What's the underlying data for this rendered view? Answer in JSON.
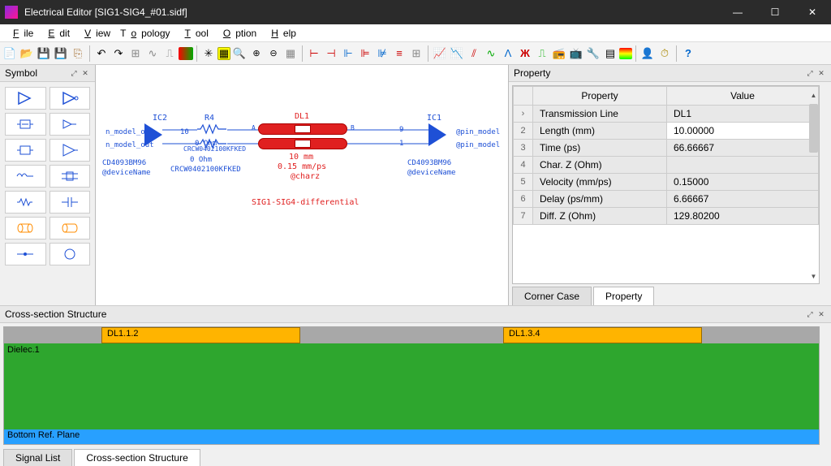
{
  "window": {
    "title": "Electrical Editor [SIG1-SIG4_#01.sidf]"
  },
  "menu": {
    "file": "File",
    "edit": "Edit",
    "view": "View",
    "topology": "Topology",
    "tool": "Tool",
    "option": "Option",
    "help": "Help"
  },
  "symbol_panel": {
    "title": "Symbol"
  },
  "canvas": {
    "ic2": "IC2",
    "ic1": "IC1",
    "r4": "R4",
    "r4ohm": "0 Ohm",
    "r4val": "10",
    "dl1": "DL1",
    "dl1a": "A",
    "dl1b": "B",
    "dl1mm": "10 mm",
    "dl1mmps": "0.15 mm/ps",
    "dl1charz": "@charz",
    "pn_out": "n_model_out",
    "pn_out2": "n_model_out",
    "pn_in": "@pin_model",
    "pn_in2": "@pin_model",
    "cd1": "CD4093BM96",
    "cd1dev": "@deviceName",
    "cd2": "CD4093BM96",
    "cd2dev": "@deviceName",
    "crcw": "CRCW0402100KFKED",
    "crcw2": "CRCW0402100KFKED",
    "ohm0": "0 Ohm",
    "bus9": "9",
    "bus1": "1",
    "netname": "SIG1-SIG4-differential"
  },
  "property": {
    "title": "Property",
    "headers": {
      "prop": "Property",
      "val": "Value"
    },
    "rows": [
      {
        "n": "›",
        "k": "Transmission Line",
        "v": "DL1"
      },
      {
        "n": "2",
        "k": "Length (mm)",
        "v": "10.00000"
      },
      {
        "n": "3",
        "k": "Time (ps)",
        "v": "66.66667"
      },
      {
        "n": "4",
        "k": "Char. Z (Ohm)",
        "v": ""
      },
      {
        "n": "5",
        "k": "Velocity (mm/ps)",
        "v": "0.15000"
      },
      {
        "n": "6",
        "k": "Delay (ps/mm)",
        "v": "6.66667"
      },
      {
        "n": "7",
        "k": "Diff. Z (Ohm)",
        "v": "129.80200"
      }
    ],
    "tabs": {
      "corner": "Corner Case",
      "property": "Property"
    }
  },
  "xsection": {
    "title": "Cross-section Structure",
    "trace1": "DL1.1.2",
    "trace2": "DL1.3.4",
    "dielec": "Dielec.1",
    "bottomref": "Bottom Ref. Plane",
    "tabs": {
      "signal": "Signal List",
      "xsec": "Cross-section Structure"
    }
  }
}
